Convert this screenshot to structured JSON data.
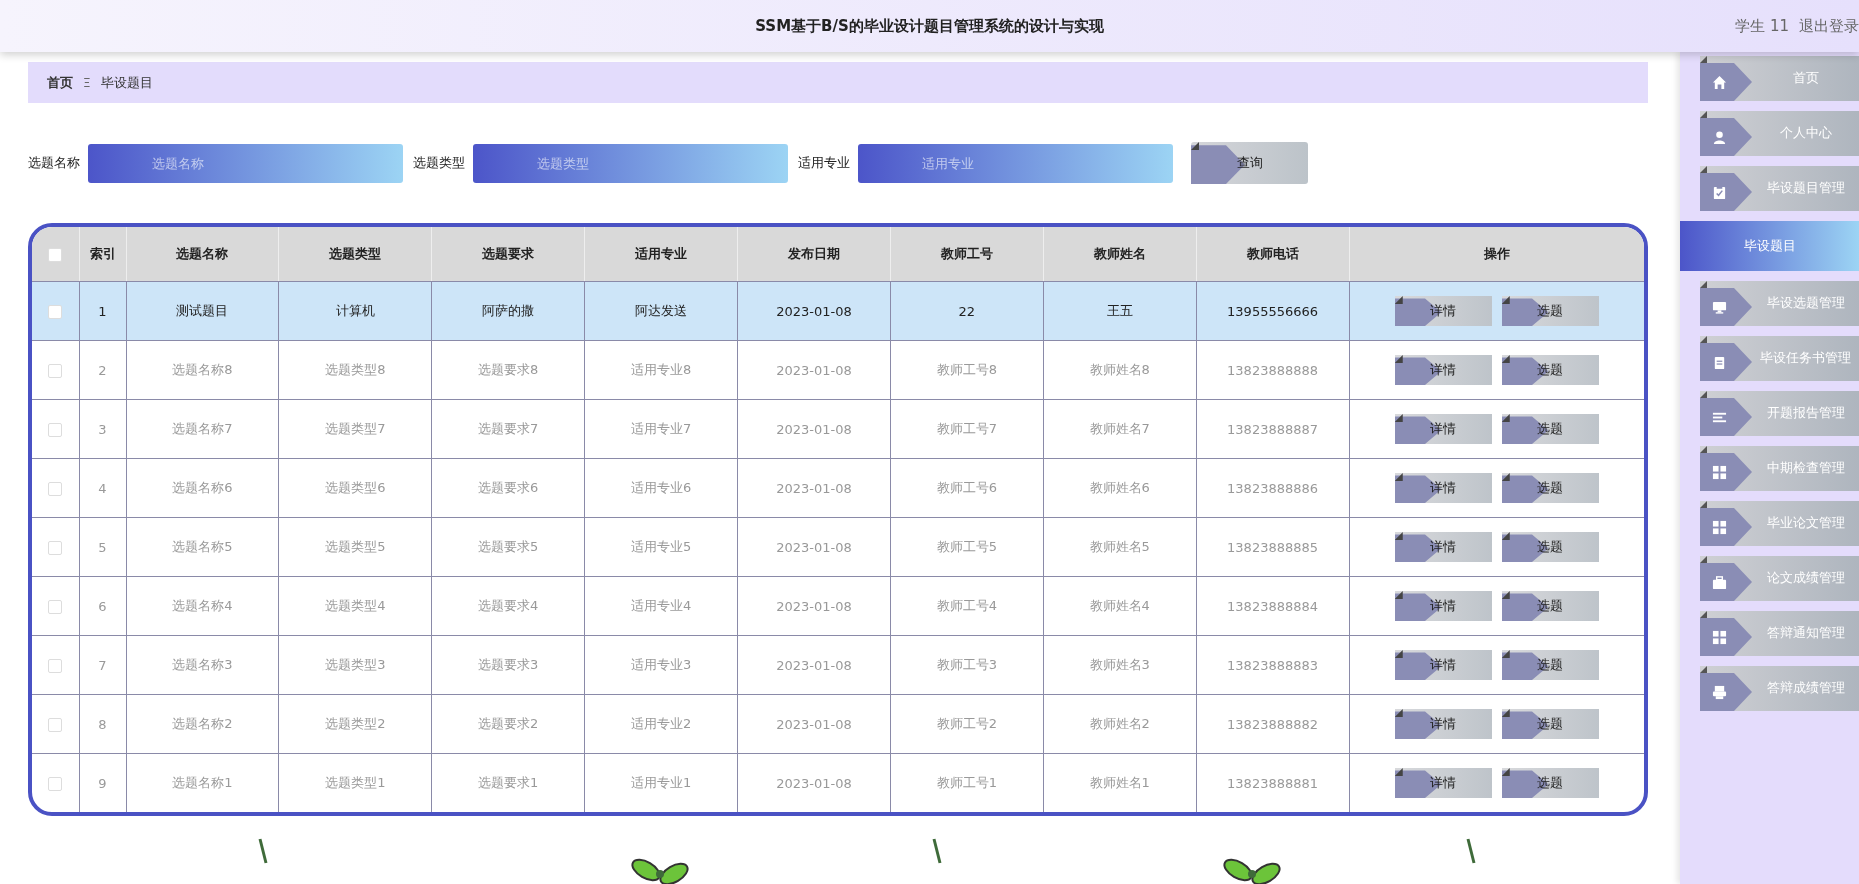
{
  "header": {
    "title": "SSM基于B/S的毕业设计题目管理系统的设计与实现",
    "user": "学生 11",
    "logout": "退出登录"
  },
  "breadcrumb": {
    "items": [
      "首页",
      "毕设题目"
    ],
    "separator": "Ξ"
  },
  "search": {
    "fields": [
      {
        "label": "选题名称",
        "placeholder": "选题名称"
      },
      {
        "label": "选题类型",
        "placeholder": "选题类型"
      },
      {
        "label": "适用专业",
        "placeholder": "适用专业"
      }
    ],
    "button": "查询"
  },
  "table": {
    "header_checkbox": {
      "checked": false
    },
    "columns": [
      "索引",
      "选题名称",
      "选题类型",
      "选题要求",
      "适用专业",
      "发布日期",
      "教师工号",
      "教师姓名",
      "教师电话",
      "操作"
    ],
    "rows": [
      {
        "checked": false,
        "selected": true,
        "cells": [
          "1",
          "测试题目",
          "计算机",
          "阿萨的撒",
          "阿达发送",
          "2023-01-08",
          "22",
          "王五",
          "13955556666"
        ],
        "actions": [
          "详情",
          "选题"
        ]
      },
      {
        "checked": false,
        "selected": false,
        "cells": [
          "2",
          "选题名称8",
          "选题类型8",
          "选题要求8",
          "适用专业8",
          "2023-01-08",
          "教师工号8",
          "教师姓名8",
          "13823888888"
        ],
        "actions": [
          "详情",
          "选题"
        ]
      },
      {
        "checked": false,
        "selected": false,
        "cells": [
          "3",
          "选题名称7",
          "选题类型7",
          "选题要求7",
          "适用专业7",
          "2023-01-08",
          "教师工号7",
          "教师姓名7",
          "13823888887"
        ],
        "actions": [
          "详情",
          "选题"
        ]
      },
      {
        "checked": false,
        "selected": false,
        "cells": [
          "4",
          "选题名称6",
          "选题类型6",
          "选题要求6",
          "适用专业6",
          "2023-01-08",
          "教师工号6",
          "教师姓名6",
          "13823888886"
        ],
        "actions": [
          "详情",
          "选题"
        ]
      },
      {
        "checked": false,
        "selected": false,
        "cells": [
          "5",
          "选题名称5",
          "选题类型5",
          "选题要求5",
          "适用专业5",
          "2023-01-08",
          "教师工号5",
          "教师姓名5",
          "13823888885"
        ],
        "actions": [
          "详情",
          "选题"
        ]
      },
      {
        "checked": false,
        "selected": false,
        "cells": [
          "6",
          "选题名称4",
          "选题类型4",
          "选题要求4",
          "适用专业4",
          "2023-01-08",
          "教师工号4",
          "教师姓名4",
          "13823888884"
        ],
        "actions": [
          "详情",
          "选题"
        ]
      },
      {
        "checked": false,
        "selected": false,
        "cells": [
          "7",
          "选题名称3",
          "选题类型3",
          "选题要求3",
          "适用专业3",
          "2023-01-08",
          "教师工号3",
          "教师姓名3",
          "13823888883"
        ],
        "actions": [
          "详情",
          "选题"
        ]
      },
      {
        "checked": false,
        "selected": false,
        "cells": [
          "8",
          "选题名称2",
          "选题类型2",
          "选题要求2",
          "适用专业2",
          "2023-01-08",
          "教师工号2",
          "教师姓名2",
          "13823888882"
        ],
        "actions": [
          "详情",
          "选题"
        ]
      },
      {
        "checked": false,
        "selected": false,
        "cells": [
          "9",
          "选题名称1",
          "选题类型1",
          "选题要求1",
          "适用专业1",
          "2023-01-08",
          "教师工号1",
          "教师姓名1",
          "13823888881"
        ],
        "actions": [
          "详情",
          "选题"
        ]
      }
    ]
  },
  "sidebar": {
    "items": [
      {
        "label": "首页",
        "selected": false
      },
      {
        "label": "个人中心",
        "selected": false
      },
      {
        "label": "毕设题目管理",
        "selected": false
      },
      {
        "label": "毕设题目",
        "selected": true
      },
      {
        "label": "毕设选题管理",
        "selected": false
      },
      {
        "label": "毕设任务书管理",
        "selected": false
      },
      {
        "label": "开题报告管理",
        "selected": false
      },
      {
        "label": "中期检查管理",
        "selected": false
      },
      {
        "label": "毕业论文管理",
        "selected": false
      },
      {
        "label": "论文成绩管理",
        "selected": false
      },
      {
        "label": "答辩通知管理",
        "selected": false
      },
      {
        "label": "答辩成绩管理",
        "selected": false
      }
    ]
  }
}
